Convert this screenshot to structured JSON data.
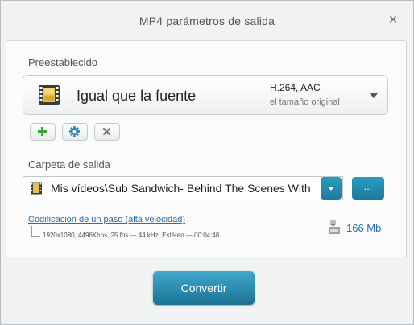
{
  "window": {
    "title": "MP4 parámetros de salida",
    "close_glyph": "×"
  },
  "preset": {
    "section_label": "Preestablecido",
    "name": "Igual que la fuente",
    "codec": "H.264, AAC",
    "size_mode": "el tamaño original",
    "icon": "film-icon"
  },
  "preset_actions": [
    {
      "name": "add-preset-button",
      "icon": "plus-icon",
      "color": "#3aa53a"
    },
    {
      "name": "settings-preset-button",
      "icon": "gear-icon",
      "color": "#2b7fb8"
    },
    {
      "name": "delete-preset-button",
      "icon": "close-icon",
      "color": "#777777"
    }
  ],
  "output": {
    "section_label": "Carpeta de salida",
    "folder_path": "Mis vídeos\\Sub Sandwich- Behind The Scenes With",
    "browse_label": "..."
  },
  "encoding": {
    "link_text": "Codificación de un paso (alta velocidad)",
    "details": "1920x1080, 4496Kbps, 25 fps — 44 kHz, Estéreo — 00:04:48",
    "estimated_size": "166 Mb"
  },
  "convert_label": "Convertir",
  "colors": {
    "accent": "#1f84a8",
    "link": "#2a6fb0"
  }
}
